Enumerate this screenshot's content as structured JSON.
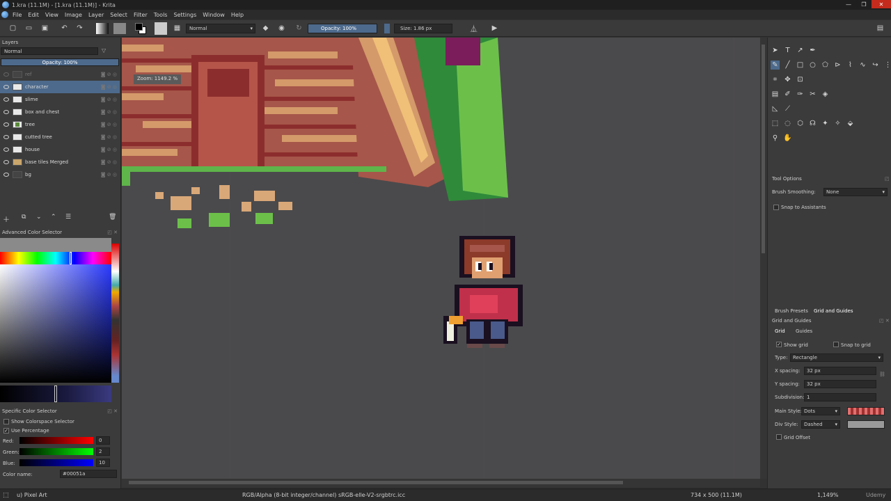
{
  "window": {
    "title": "1.kra (11.1M)  - [1.kra (11.1M)] - Krita"
  },
  "menu": [
    "File",
    "Edit",
    "View",
    "Image",
    "Layer",
    "Select",
    "Filter",
    "Tools",
    "Settings",
    "Window",
    "Help"
  ],
  "toolbar": {
    "blend_mode": "Normal",
    "opacity_label": "Opacity:  100%",
    "size_label": "Size:  1.86 px"
  },
  "layers_panel": {
    "title": "Layers",
    "blend_mode": "Normal",
    "opacity": "Opacity:  100%",
    "layers": [
      {
        "name": "ref",
        "selected": false,
        "dim": true
      },
      {
        "name": "character",
        "selected": true,
        "dim": false
      },
      {
        "name": "slime",
        "selected": false,
        "dim": false
      },
      {
        "name": "box and chest",
        "selected": false,
        "dim": false
      },
      {
        "name": "tree",
        "selected": false,
        "dim": false
      },
      {
        "name": "cutted tree",
        "selected": false,
        "dim": false
      },
      {
        "name": "house",
        "selected": false,
        "dim": false
      },
      {
        "name": "base tiles Merged",
        "selected": false,
        "dim": false
      },
      {
        "name": "bg",
        "selected": false,
        "dim": false
      }
    ]
  },
  "advanced_color": {
    "title": "Advanced Color Selector"
  },
  "specific_color": {
    "title": "Specific Color Selector",
    "show_colorspace": "Show Colorspace Selector",
    "use_percentage": "Use Percentage",
    "red_label": "Red:",
    "red_value": "0",
    "green_label": "Green:",
    "green_value": "2",
    "blue_label": "Blue:",
    "blue_value": "10",
    "color_name_label": "Color name:",
    "color_name_value": "#00051a"
  },
  "canvas": {
    "zoom_tooltip": "Zoom: 1149.2 %"
  },
  "tool_options": {
    "title": "Tool Options",
    "smoothing_label": "Brush Smoothing:",
    "smoothing_value": "None",
    "snap_assistants": "Snap to Assistants"
  },
  "bottom_tabs": [
    "Brush Presets",
    "Grid and Guides"
  ],
  "grid_guides": {
    "title": "Grid and Guides",
    "tabs": [
      "Grid",
      "Guides"
    ],
    "show_grid": "Show grid",
    "snap_grid": "Snap to grid",
    "type_label": "Type:",
    "type_value": "Rectangle",
    "xspacing_label": "X spacing:",
    "xspacing_value": "32 px",
    "yspacing_label": "Y spacing:",
    "yspacing_value": "32 px",
    "subdivision_label": "Subdivision:",
    "subdivision_value": "1",
    "main_style_label": "Main Style:",
    "main_style_value": "Dots",
    "div_style_label": "Div Style:",
    "div_style_value": "Dashed",
    "grid_offset": "Grid Offset"
  },
  "statusbar": {
    "brush": "u) Pixel Art",
    "colorspace": "RGB/Alpha (8-bit integer/channel)  sRGB-elle-V2-srgbtrc.icc",
    "dimensions": "734 x 500 (11.1M)",
    "zoom": "1,149%",
    "watermark": "Udemy"
  },
  "colors": {
    "accent": "#4d6a8c",
    "canvas_bg": "#4a4a4c",
    "main_grid_color": "#e07070",
    "selected_color": "#00051a"
  }
}
